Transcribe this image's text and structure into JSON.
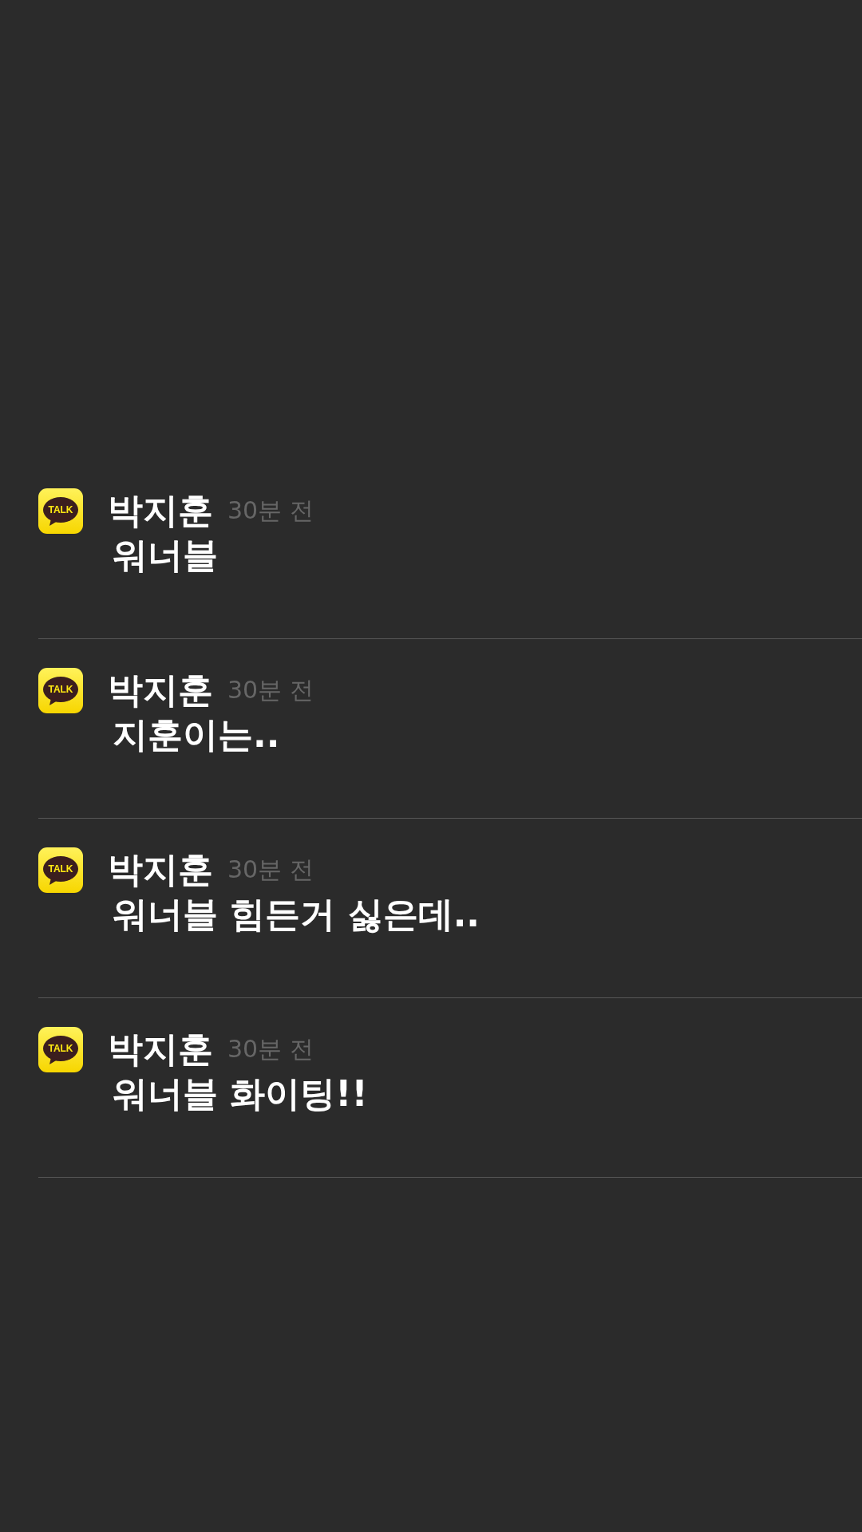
{
  "notifications": [
    {
      "app_icon_label": "TALK",
      "sender": "박지훈",
      "time": "30분 전",
      "message": "워너블"
    },
    {
      "app_icon_label": "TALK",
      "sender": "박지훈",
      "time": "30분 전",
      "message": "지훈이는.."
    },
    {
      "app_icon_label": "TALK",
      "sender": "박지훈",
      "time": "30분 전",
      "message": "워너블 힘든거 싫은데.."
    },
    {
      "app_icon_label": "TALK",
      "sender": "박지훈",
      "time": "30분 전",
      "message": "워너블 화이팅!!"
    }
  ]
}
